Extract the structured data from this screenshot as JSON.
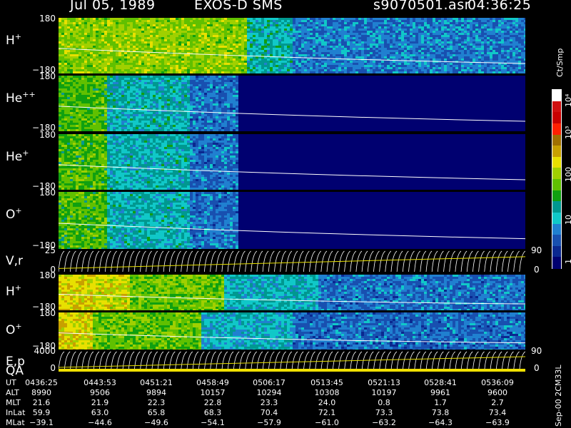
{
  "header": {
    "date": "Jul 05, 1989",
    "instrument": "EXOS-D SMS",
    "filename": "s9070501.asr",
    "time": "04:36:25"
  },
  "panels": [
    {
      "id": "h-plus-1",
      "species": "H",
      "charge": "+",
      "ytop": "180",
      "ybot": "−180",
      "type": "spectrogram"
    },
    {
      "id": "he-plus-plus",
      "species": "He",
      "charge": "++",
      "ytop": "180",
      "ybot": "−180",
      "type": "spectrogram"
    },
    {
      "id": "he-plus",
      "species": "He",
      "charge": "+",
      "ytop": "180",
      "ybot": "−180",
      "type": "spectrogram"
    },
    {
      "id": "o-plus-1",
      "species": "O",
      "charge": "+",
      "ytop": "180",
      "ybot": "−180",
      "type": "spectrogram"
    },
    {
      "id": "v-r",
      "label": "V,r",
      "ytop": "25",
      "ybot": "0",
      "rtop": "90",
      "rbot": "0",
      "type": "lines"
    },
    {
      "id": "h-plus-2",
      "species": "H",
      "charge": "+",
      "ytop": "180",
      "ybot": "−180",
      "type": "spectrogram"
    },
    {
      "id": "o-plus-2",
      "species": "O",
      "charge": "+",
      "ytop": "180",
      "ybot": "−180",
      "type": "spectrogram"
    },
    {
      "id": "e-p",
      "label": "E,p",
      "ytop": "4000",
      "ybot": "0",
      "rtop": "90",
      "rbot": "0",
      "type": "lines"
    }
  ],
  "qa_label": "QA",
  "colorbar": {
    "units": "Ct/Smp",
    "labels": [
      "10⁴",
      "10³",
      "100",
      "10",
      "1"
    ],
    "colors": [
      "#ffffff",
      "#d01010",
      "#c80000",
      "#ff2000",
      "#a07000",
      "#c8a000",
      "#e8e000",
      "#a0d000",
      "#60c000",
      "#10a010",
      "#009890",
      "#10c8c8",
      "#2080d0",
      "#1850b0",
      "#0a2890",
      "#000070"
    ]
  },
  "table": {
    "rows": [
      {
        "label": "UT",
        "values": [
          "0436:25",
          "0443:53",
          "0451:21",
          "0458:49",
          "0506:17",
          "0513:45",
          "0521:13",
          "0528:41",
          "0536:09"
        ]
      },
      {
        "label": "ALT",
        "values": [
          "8990",
          "9506",
          "9894",
          "10157",
          "10294",
          "10308",
          "10197",
          "9961",
          "9600"
        ]
      },
      {
        "label": "MLT",
        "values": [
          "21.6",
          "21.9",
          "22.3",
          "22.8",
          "23.3",
          "24.0",
          "0.8",
          "1.7",
          "2.7"
        ]
      },
      {
        "label": "InLat",
        "values": [
          "59.9",
          "63.0",
          "65.8",
          "68.3",
          "70.4",
          "72.1",
          "73.3",
          "73.8",
          "73.4"
        ]
      },
      {
        "label": "MLat",
        "values": [
          "−39.1",
          "−44.6",
          "−49.6",
          "−54.1",
          "−57.9",
          "−61.0",
          "−63.2",
          "−64.3",
          "−63.9"
        ]
      }
    ]
  },
  "side_code": "Sep-00 2CM33L"
}
